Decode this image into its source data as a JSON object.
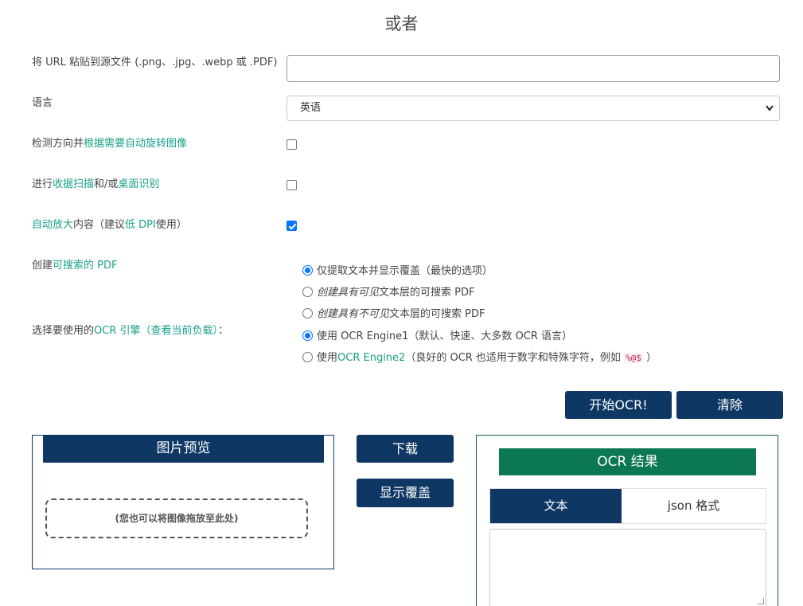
{
  "heading": "或者",
  "url_field": {
    "label": "将 URL 粘贴到源文件 (.png、.jpg、.webp 或 .PDF)",
    "value": "",
    "placeholder": ""
  },
  "language": {
    "label": "语言",
    "selected": "英语",
    "chevron_icon": "chevron-down-icon"
  },
  "orientation": {
    "label_prefix": "检测方向并",
    "label_link": "根据需要自动旋转图像",
    "checked": false
  },
  "receipt_table": {
    "label_prefix": "进行",
    "link1": "收据扫描",
    "mid": "和/或",
    "link2": "桌面识别",
    "checked": false
  },
  "upscale": {
    "link": "自动放大",
    "mid": "内容（建议",
    "link2": "低 DPI",
    "suffix": "使用）",
    "checked": true
  },
  "searchable_pdf": {
    "label_prefix": "创建",
    "label_link": "可搜索的 PDF",
    "options": [
      {
        "text": "仅提取文本并显示覆盖（最快的选项）",
        "selected": true
      },
      {
        "italic": "创建具有可见",
        "text": "文本层的可搜索 PDF",
        "selected": false
      },
      {
        "italic": "创建具有不可见",
        "text": "文本层的可搜索 PDF",
        "selected": false
      }
    ]
  },
  "ocr_engine": {
    "label_prefix": "选择要使用的",
    "label_link": "OCR 引擎（查看当前负载）",
    "label_suffix": "：",
    "options": [
      {
        "text": "使用 OCR Engine1（默认、快速、大多数 OCR 语言）",
        "selected": true
      },
      {
        "prefix": "使用",
        "link": "OCR Engine2",
        "text": "（良好的 OCR 也适用于数字和特殊字符，例如",
        "code": "%@$",
        "suffix": "）",
        "selected": false
      }
    ]
  },
  "buttons": {
    "start": "开始OCR!",
    "clear": "清除",
    "download": "下载",
    "show_overlay": "显示覆盖"
  },
  "preview": {
    "title": "图片预览",
    "drop_hint": "(您也可以将图像拖放至此处)"
  },
  "result": {
    "title": "OCR 结果",
    "tabs": [
      "文本",
      "json 格式"
    ],
    "active_tab": "文本",
    "text": ""
  },
  "colors": {
    "navy": "#0e3764",
    "green": "#0c7753",
    "link": "#18a08a",
    "checkbox_blue": "#0075ff"
  }
}
